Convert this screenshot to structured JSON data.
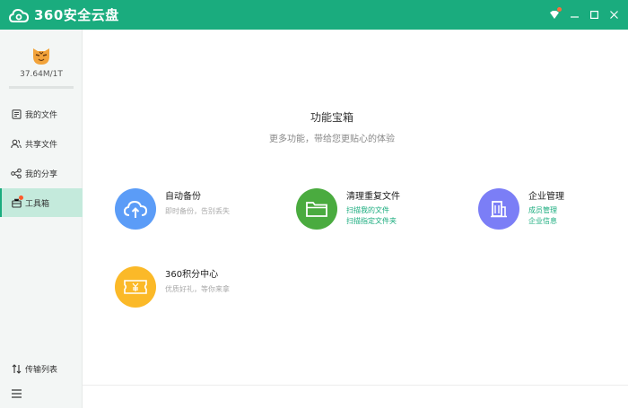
{
  "app": {
    "title": "360安全云盘"
  },
  "user": {
    "quota": "37.64M/1T"
  },
  "sidebar": {
    "items": [
      {
        "label": "我的文件"
      },
      {
        "label": "共享文件"
      },
      {
        "label": "我的分享"
      },
      {
        "label": "工具箱"
      }
    ],
    "transfer_label": "传输列表"
  },
  "toolbox": {
    "title": "功能宝箱",
    "subtitle": "更多功能，带给您更贴心的体验",
    "cards": [
      {
        "title": "自动备份",
        "desc": "即时备份，告别丢失"
      },
      {
        "title": "清理重复文件",
        "links": [
          "扫描我的文件",
          "扫描指定文件夹"
        ]
      },
      {
        "title": "企业管理",
        "links": [
          "成员管理",
          "企业信息"
        ]
      },
      {
        "title": "360积分中心",
        "desc": "优质好礼，等你来拿"
      }
    ]
  },
  "colors": {
    "brand": "#1aac7e",
    "backup": "#5b9cf7",
    "clean": "#4aab3f",
    "enterprise": "#7b7ef6",
    "points": "#fbb928"
  }
}
